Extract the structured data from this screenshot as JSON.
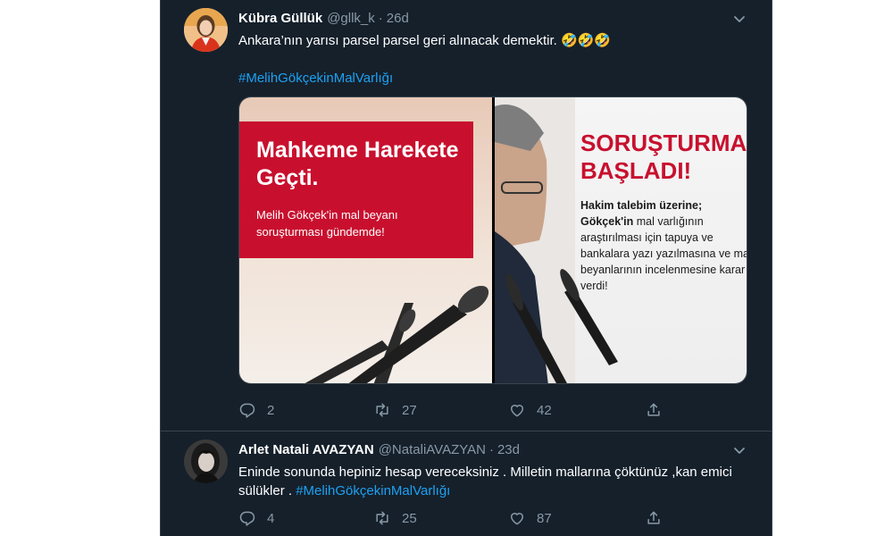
{
  "tweets": [
    {
      "name": "Kübra Güllük",
      "handle": "@gllk_k",
      "dot": "·",
      "time": "26d",
      "text": "Ankara’nın yarısı parsel parsel geri alınacak demektir. 🤣🤣🤣",
      "hashtag": "#MelihGökçekinMalVarlığı",
      "media": {
        "left_title": "Mahkeme Harekete Geçti.",
        "left_subtitle": "Melih Gökçek'in mal beyanı soruşturması gündemde!",
        "right_title": "SORUŞTURMA\nBAŞLADI!",
        "right_lead": "Hakim talebim üzerine;",
        "right_name": "Gökçek'in",
        "right_body": " mal varlığının araştırılması için tapuya ve bankalara yazı yazılmasına ve mal beyanlarının incelenmesine karar verdi!"
      },
      "stats": {
        "replies": "2",
        "retweets": "27",
        "likes": "42"
      }
    },
    {
      "name": "Arlet Natali AVAZYAN",
      "handle": "@NataliAVAZYAN",
      "dot": "·",
      "time": "23d",
      "text": "Eninde  sonunda hepiniz hesap vereceksiniz . Milletin mallarına çöktünüz ,kan emici sülükler . ",
      "hashtag": "#MelihGökçekinMalVarlığı",
      "stats": {
        "replies": "4",
        "retweets": "25",
        "likes": "87"
      }
    }
  ],
  "colors": {
    "background": "#15202b",
    "border": "#38444d",
    "text": "#ffffff",
    "muted": "#8899a6",
    "link": "#1da1f2",
    "accent_red": "#c8102e"
  },
  "icons": [
    "chevron-down-icon",
    "reply-icon",
    "retweet-icon",
    "like-icon",
    "share-icon"
  ]
}
